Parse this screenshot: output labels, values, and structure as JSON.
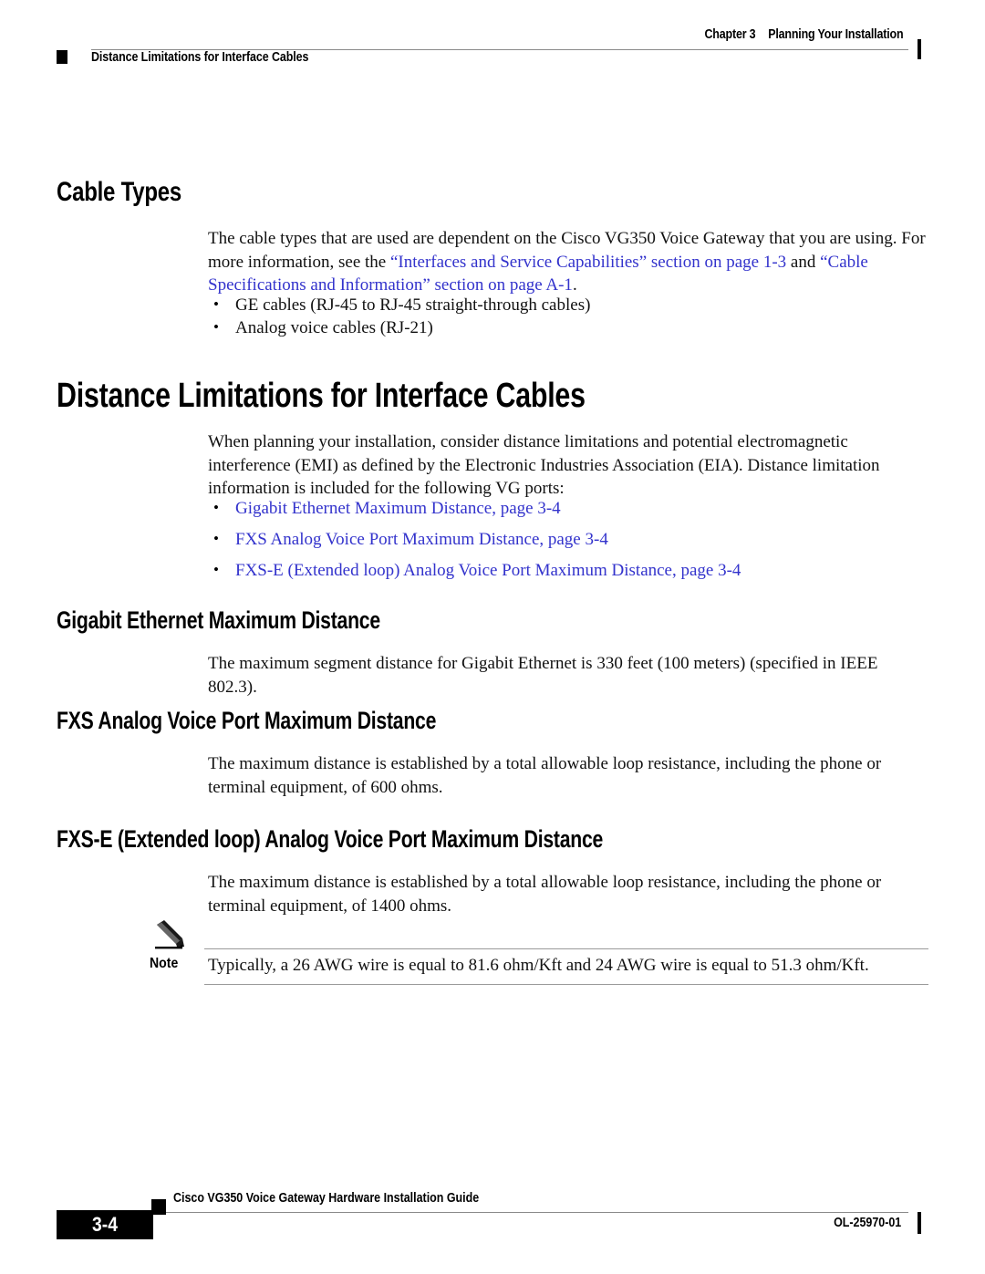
{
  "header": {
    "chapter_number": "Chapter 3",
    "chapter_title": "Planning Your Installation",
    "running_title": "Distance Limitations for Interface Cables"
  },
  "sections": {
    "cable_types": {
      "heading": "Cable Types",
      "paragraph_lead": "The cable types that are used are dependent on the Cisco VG350 Voice Gateway that you are using. For more information, see the ",
      "link_1": "“Interfaces and Service Capabilities” section on page 1-3",
      "paragraph_mid": " and ",
      "link_2": "“Cable Specifications and Information” section on page A-1",
      "paragraph_end": ".",
      "bullets": [
        "GE cables (RJ-45 to RJ-45 straight-through cables)",
        "Analog voice cables (RJ-21)"
      ]
    },
    "distance_limitations": {
      "heading": "Distance Limitations for Interface Cables",
      "paragraph": "When planning your installation, consider distance limitations and potential electromagnetic interference (EMI) as defined by the Electronic Industries Association (EIA). Distance limitation information is included for the following VG ports:",
      "link_bullets": [
        "Gigabit Ethernet Maximum Distance, page 3-4",
        "FXS Analog Voice Port Maximum Distance, page 3-4",
        "FXS-E (Extended loop) Analog Voice Port Maximum Distance, page 3-4"
      ]
    },
    "gigabit_ethernet": {
      "heading": "Gigabit Ethernet Maximum Distance",
      "paragraph": "The maximum segment distance for Gigabit Ethernet is 330 feet (100 meters) (specified in IEEE 802.3)."
    },
    "fxs_analog": {
      "heading": "FXS Analog Voice Port Maximum Distance",
      "paragraph": "The maximum distance is established by a total allowable loop resistance, including the phone or terminal equipment, of 600 ohms."
    },
    "fxs_e_analog": {
      "heading": "FXS-E (Extended loop) Analog Voice Port Maximum Distance",
      "paragraph": "The maximum distance is established by a total allowable loop resistance, including the phone or terminal equipment, of 1400 ohms."
    }
  },
  "note": {
    "label": "Note",
    "icon": "pencil-icon",
    "text": "Typically, a 26 AWG wire is equal to 81.6 ohm/Kft and 24 AWG wire is equal to 51.3 ohm/Kft."
  },
  "footer": {
    "page_number": "3-4",
    "guide_title": "Cisco VG350 Voice Gateway Hardware Installation Guide",
    "document_id": "OL-25970-01"
  },
  "colors": {
    "link": "#3333cc",
    "rule": "#8a8a8a",
    "text": "#111111",
    "black": "#000000"
  }
}
